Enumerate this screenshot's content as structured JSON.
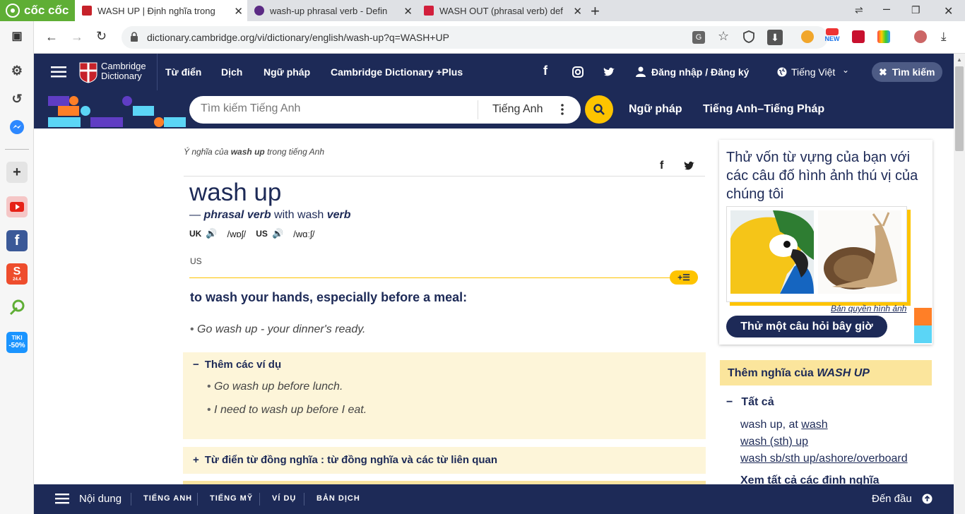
{
  "browser": {
    "brand": "cốc cốc",
    "tabs": [
      {
        "title": "WASH UP | Định nghĩa trong"
      },
      {
        "title": "wash-up phrasal verb - Defin"
      },
      {
        "title": "WASH OUT (phrasal verb) def"
      }
    ],
    "url": "dictionary.cambridge.org/vi/dictionary/english/wash-up?q=WASH+UP",
    "ext_new_badge": "NEW"
  },
  "sidebar": {
    "shopee_badge": "24.4",
    "tiki_label": "TIKI",
    "tiki_discount": "-50%"
  },
  "header": {
    "logo_line1": "Cambridge",
    "logo_line2": "Dictionary",
    "nav": [
      "Từ điển",
      "Dịch",
      "Ngữ pháp",
      "Cambridge Dictionary +Plus"
    ],
    "login": "Đăng nhập / Đăng ký",
    "language": "Tiếng Việt",
    "close_search": "Tìm kiếm"
  },
  "search": {
    "placeholder": "Tìm kiếm Tiếng Anh",
    "dict_select": "Tiếng Anh",
    "links": [
      "Ngữ pháp",
      "Tiếng Anh–Tiếng Pháp"
    ]
  },
  "entry": {
    "kicker_prefix": "Ý nghĩa của ",
    "kicker_word": "wash up",
    "kicker_suffix": " trong tiếng Anh",
    "headword": "wash up",
    "pos_dash": "— ",
    "pos": "phrasal verb",
    "pos_with": " with wash ",
    "pos_verb": "verb",
    "uk_label": "UK",
    "uk_ipa": "/wɒʃ/",
    "us_label": "US",
    "us_ipa": "/wɑːʃ/",
    "region": "US",
    "definition": "to wash your hands, especially before a meal:",
    "example": "Go wash up - your dinner's ready.",
    "more_examples_label": "Thêm các ví dụ",
    "more_examples": [
      "Go wash up before lunch.",
      "I need to wash up before I eat."
    ],
    "thesaurus_label": "Từ điển từ đồng nghĩa : từ đồng nghĩa và các từ liên quan"
  },
  "quiz": {
    "title": "Thử vốn từ vựng của bạn với các câu đố hình ảnh thú vị của chúng tôi",
    "copyright": "Bản quyền hình ảnh",
    "button": "Thử một câu hỏi bây giờ"
  },
  "more_meanings": {
    "title_prefix": "Thêm nghĩa của ",
    "title_word": "WASH UP",
    "all_label": "Tất cả",
    "links": [
      {
        "pre": "wash up, at ",
        "link": "wash"
      },
      {
        "pre": "",
        "link": "wash (sth) up"
      },
      {
        "pre": "",
        "link": "wash sb/sth up/ashore/overboard"
      }
    ],
    "see_all": "Xem tất cả các định nghĩa"
  },
  "bottom": {
    "contents": "Nội dung",
    "items": [
      "TIẾNG ANH",
      "TIẾNG MỸ",
      "VÍ DỤ",
      "BẢN DỊCH"
    ],
    "top": "Đến đầu"
  },
  "colors": {
    "navy": "#1d2a57",
    "yellow": "#fec400",
    "cream": "#fdf5d9",
    "coccoc_green": "#5fae35"
  }
}
